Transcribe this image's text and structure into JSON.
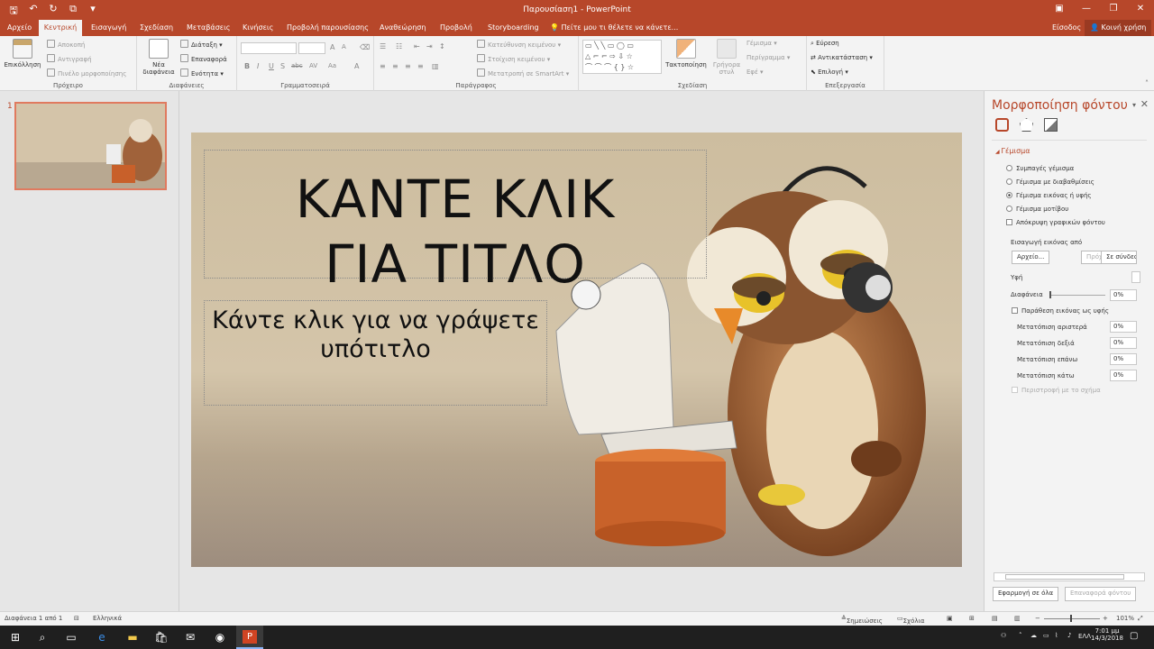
{
  "window": {
    "title": "Παρουσίαση1 - PowerPoint"
  },
  "tabs": [
    {
      "label": "Αρχείο"
    },
    {
      "label": "Κεντρική"
    },
    {
      "label": "Εισαγωγή"
    },
    {
      "label": "Σχεδίαση"
    },
    {
      "label": "Μεταβάσεις"
    },
    {
      "label": "Κινήσεις"
    },
    {
      "label": "Προβολή παρουσίασης"
    },
    {
      "label": "Αναθεώρηση"
    },
    {
      "label": "Προβολή"
    },
    {
      "label": "Storyboarding"
    }
  ],
  "tell_me": "Πείτε μου τι θέλετε να κάνετε...",
  "signin": "Είσοδος",
  "share": "Κοινή χρήση",
  "ribbon": {
    "clipboard": {
      "paste": "Επικόλληση",
      "cut": "Αποκοπή",
      "copy": "Αντιγραφή",
      "painter": "Πινέλο μορφοποίησης",
      "group": "Πρόχειρο"
    },
    "slides": {
      "new": "Νέα",
      "new2": "διαφάνεια",
      "layout": "Διάταξη",
      "reset": "Επαναφορά",
      "section": "Ενότητα",
      "group": "Διαφάνειες"
    },
    "font": {
      "group": "Γραμματοσειρά",
      "b": "B",
      "i": "I",
      "u": "U",
      "s": "S",
      "abc": "abc",
      "av": "AV",
      "aa": "Aa",
      "a": "A",
      "grow": "A",
      "shrink": "A"
    },
    "paragraph": {
      "direction": "Κατεύθυνση κειμένου",
      "align": "Στοίχιση κειμένου",
      "smartart": "Μετατροπή σε SmartArt",
      "group": "Παράγραφος"
    },
    "drawing": {
      "arrange": "Τακτοποίηση",
      "quick1": "Γρήγορα",
      "quick2": "στυλ",
      "fill": "Γέμισμα",
      "outline": "Περίγραμμα",
      "effects": "Εφέ",
      "group": "Σχεδίαση"
    },
    "editing": {
      "find": "Εύρεση",
      "replace": "Αντικατάσταση",
      "select": "Επιλογή",
      "group": "Επεξεργασία"
    }
  },
  "thumbnail": {
    "number": "1"
  },
  "slide": {
    "title": "ΚΑΝΤΕ ΚΛΙΚ ΓΙΑ ΤΙΤΛΟ",
    "subtitle": "Κάντε κλικ για να γράψετε υπότιτλο"
  },
  "pane": {
    "title": "Μορφοποίηση φόντου",
    "section": "Γέμισμα",
    "options": [
      {
        "label": "Συμπαγές γέμισμα",
        "checked": false
      },
      {
        "label": "Γέμισμα με διαβαθμίσεις",
        "checked": false
      },
      {
        "label": "Γέμισμα εικόνας ή υφής",
        "checked": true
      },
      {
        "label": "Γέμισμα μοτίβου",
        "checked": false
      }
    ],
    "hide_graphics": "Απόκρυψη γραφικών φόντου",
    "insert_from": "Εισαγωγή εικόνας από",
    "btn_file": "Αρχείο...",
    "btn_clipboard": "Πρόχειρο",
    "btn_online": "Σε σύνδεσ",
    "texture": "Υφή",
    "transparency": "Διαφάνεια",
    "transparency_val": "0%",
    "tile": "Παράθεση εικόνας ως υφής",
    "offsets": [
      {
        "label": "Μετατόπιση αριστερά",
        "value": "0%"
      },
      {
        "label": "Μετατόπιση δεξιά",
        "value": "0%"
      },
      {
        "label": "Μετατόπιση επάνω",
        "value": "0%"
      },
      {
        "label": "Μετατόπιση κάτω",
        "value": "0%"
      }
    ],
    "rotate": "Περιστροφή με το σχήμα",
    "apply_all": "Εφαρμογή σε όλα",
    "reset": "Επαναφορά φόντου"
  },
  "status": {
    "slide": "Διαφάνεια 1 από 1",
    "lang": "Ελληνικά",
    "notes": "Σημειώσεις",
    "comments": "Σχόλια",
    "zoom": "101%"
  },
  "taskbar": {
    "time": "7:01 μμ",
    "date": "14/3/2018",
    "lang": "ΕΛΛ"
  }
}
